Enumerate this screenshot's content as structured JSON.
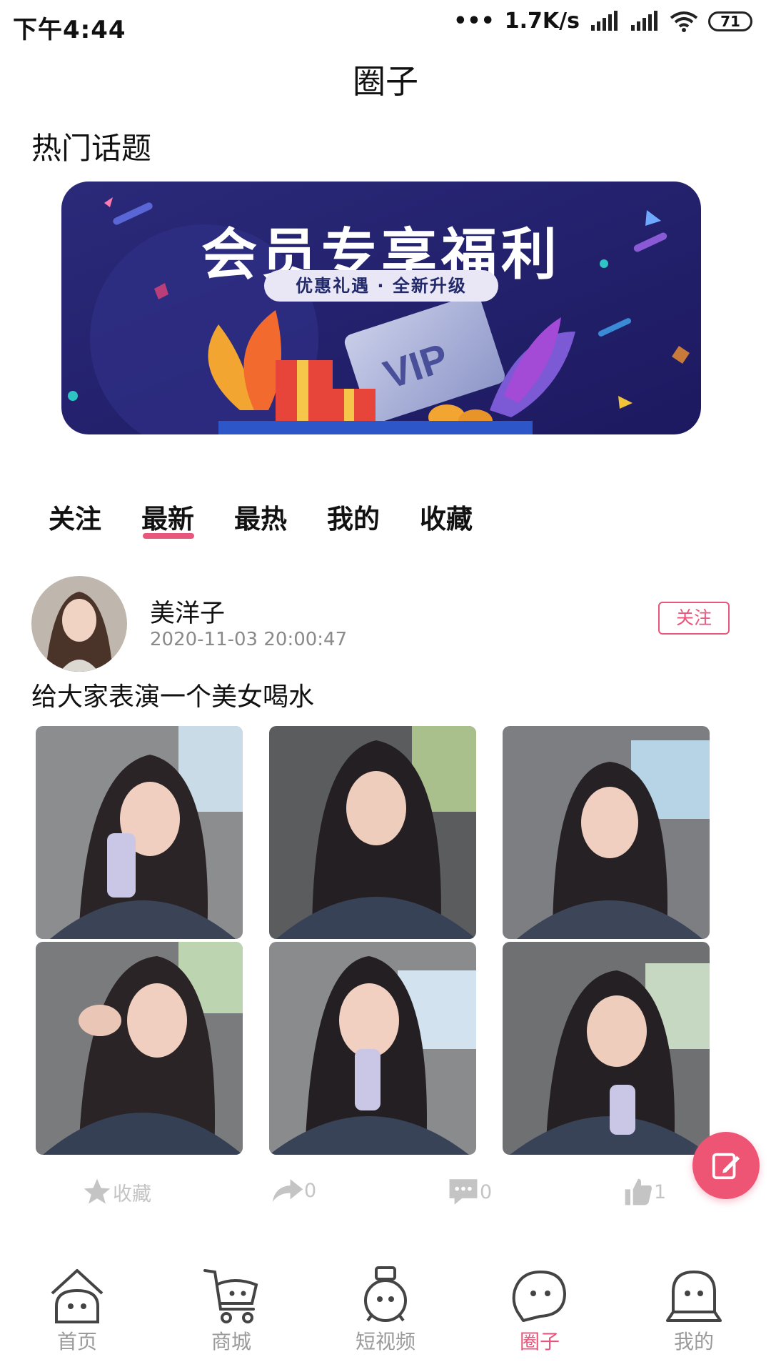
{
  "status_bar": {
    "time": "下午4:44",
    "network_speed": "1.7K/s",
    "battery": "71"
  },
  "header": {
    "title": "圈子"
  },
  "hot_topics": {
    "title": "热门话题",
    "banner": {
      "title": "会员专享福利",
      "subtitle": "优惠礼遇 · 全新升级",
      "badge": "VIP"
    }
  },
  "tabs": [
    {
      "label": "关注",
      "active": false
    },
    {
      "label": "最新",
      "active": true
    },
    {
      "label": "最热",
      "active": false
    },
    {
      "label": "我的",
      "active": false
    },
    {
      "label": "收藏",
      "active": false
    }
  ],
  "post": {
    "username": "美洋子",
    "timestamp": "2020-11-03 20:00:47",
    "follow_label": "关注",
    "text": "给大家表演一个美女喝水",
    "photo_count": 6,
    "actions": {
      "favorite_label": "收藏",
      "share_count": "0",
      "comment_count": "0",
      "like_count": "1"
    }
  },
  "bottom_nav": [
    {
      "label": "首页",
      "icon": "home-icon",
      "active": false
    },
    {
      "label": "商城",
      "icon": "cart-icon",
      "active": false
    },
    {
      "label": "短视频",
      "icon": "video-icon",
      "active": false
    },
    {
      "label": "圈子",
      "icon": "chat-bubble-icon",
      "active": true
    },
    {
      "label": "我的",
      "icon": "profile-icon",
      "active": false
    }
  ],
  "colors": {
    "accent": "#e8567c",
    "fab": "#ee5575",
    "banner_bg": "#25206b",
    "muted": "#c4c4c4"
  }
}
